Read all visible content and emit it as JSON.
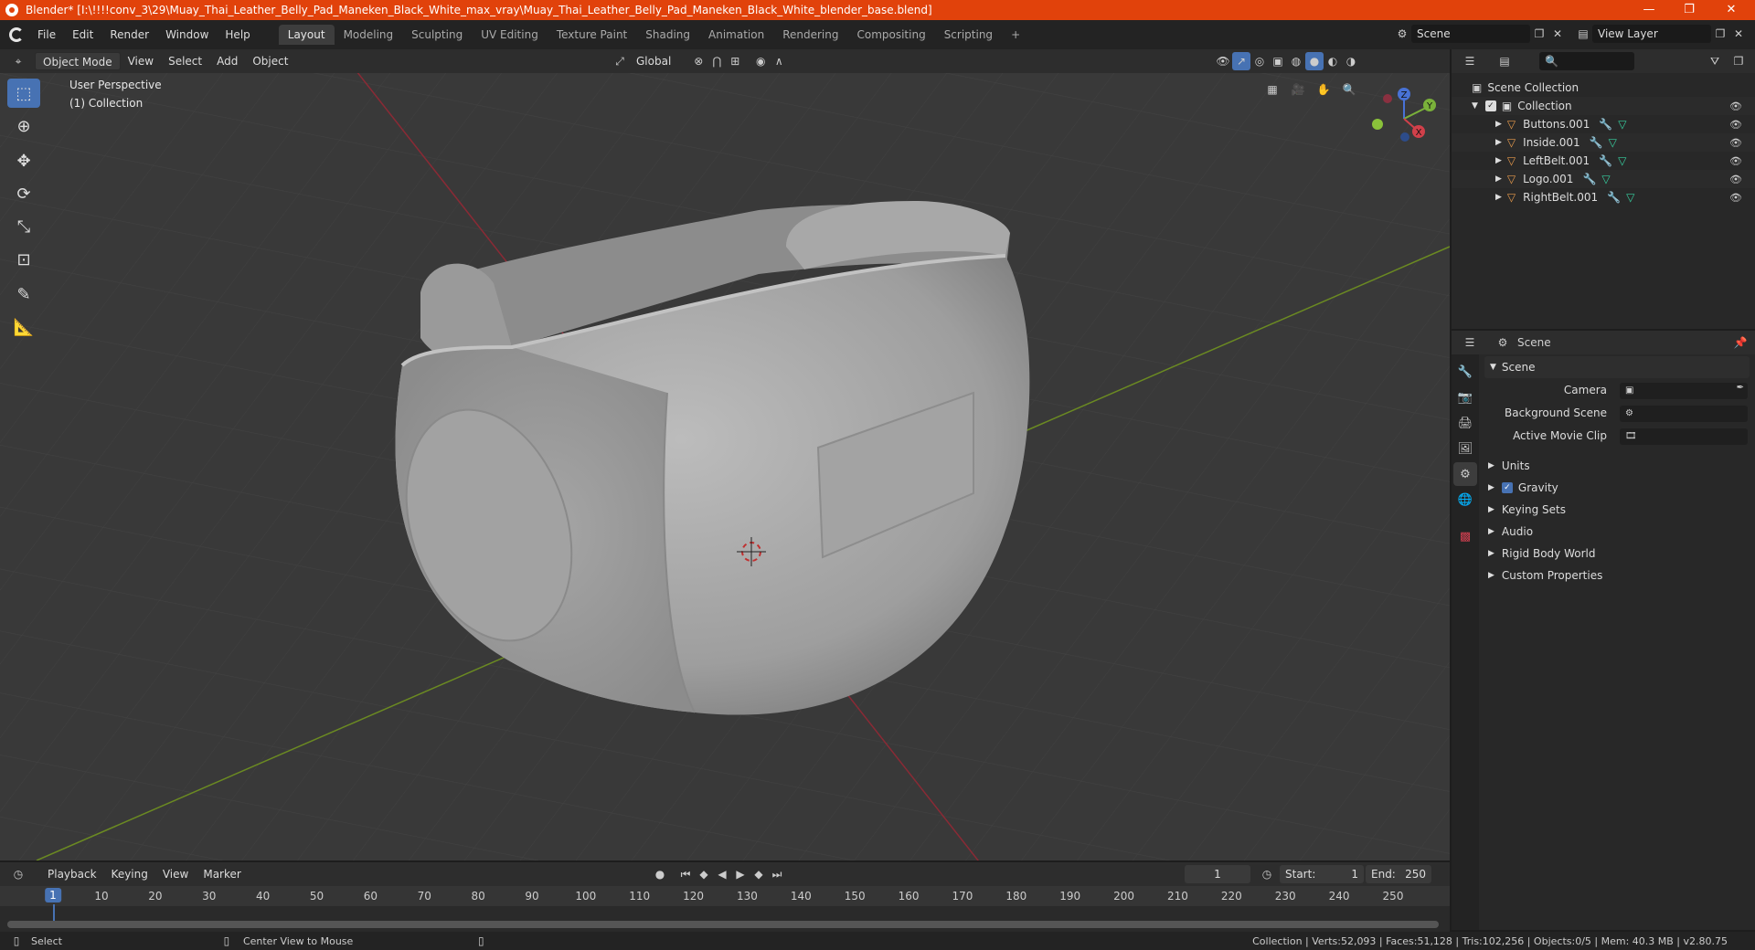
{
  "window": {
    "title": "Blender* [I:\\!!!!conv_3\\29\\Muay_Thai_Leather_Belly_Pad_Maneken_Black_White_max_vray\\Muay_Thai_Leather_Belly_Pad_Maneken_Black_White_blender_base.blend]",
    "minimize": "—",
    "maximize": "❐",
    "close": "✕"
  },
  "menu": [
    "File",
    "Edit",
    "Render",
    "Window",
    "Help"
  ],
  "workspaces": [
    "Layout",
    "Modeling",
    "Sculpting",
    "UV Editing",
    "Texture Paint",
    "Shading",
    "Animation",
    "Rendering",
    "Compositing",
    "Scripting",
    "+"
  ],
  "scene_selector": {
    "value": "Scene"
  },
  "viewlayer_selector": {
    "value": "View Layer"
  },
  "viewport_header": {
    "mode": "Object Mode",
    "menus": [
      "View",
      "Select",
      "Add",
      "Object"
    ],
    "orientation": "Global"
  },
  "viewport": {
    "perspective": "User Perspective",
    "collection": "(1) Collection",
    "gizmo_axes": [
      "X",
      "Y",
      "Z"
    ]
  },
  "timeline": {
    "menus": [
      "Playback",
      "Keying",
      "View",
      "Marker"
    ],
    "current_frame": "1",
    "start_label": "Start:",
    "start_value": "1",
    "end_label": "End:",
    "end_value": "250",
    "ticks": [
      "1",
      "10",
      "20",
      "30",
      "40",
      "50",
      "60",
      "70",
      "80",
      "90",
      "100",
      "110",
      "120",
      "130",
      "140",
      "150",
      "160",
      "170",
      "180",
      "190",
      "200",
      "210",
      "220",
      "230",
      "240",
      "250"
    ]
  },
  "status": {
    "select": "Select",
    "center": "Center View to Mouse",
    "stats": "Collection | Verts:52,093 | Faces:51,128 | Tris:102,256 | Objects:0/5 | Mem: 40.3 MB | v2.80.75"
  },
  "outliner": {
    "root": "Scene Collection",
    "collection": "Collection",
    "objects": [
      "Buttons.001",
      "Inside.001",
      "LeftBelt.001",
      "Logo.001",
      "RightBelt.001"
    ]
  },
  "properties": {
    "header": "Scene",
    "section": "Scene",
    "fields": [
      {
        "label": "Camera"
      },
      {
        "label": "Background Scene"
      },
      {
        "label": "Active Movie Clip"
      }
    ],
    "panels": [
      "Units",
      "Gravity",
      "Keying Sets",
      "Audio",
      "Rigid Body World",
      "Custom Properties"
    ]
  },
  "colors": {
    "accent": "#4772b3",
    "titlebar": "#e1420b",
    "x_axis": "#b03040",
    "y_axis": "#7a9a2a"
  }
}
